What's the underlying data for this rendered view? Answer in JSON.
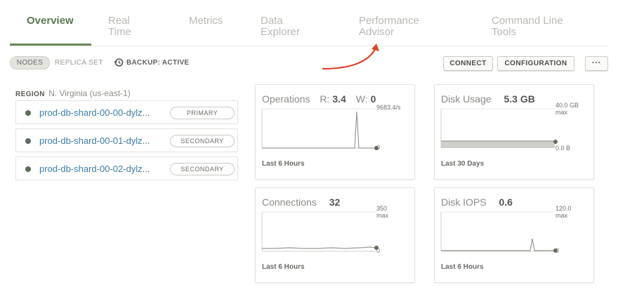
{
  "tabs": [
    {
      "label": "Overview",
      "active": true
    },
    {
      "label": "Real\nTime",
      "active": false
    },
    {
      "label": "Metrics",
      "active": false
    },
    {
      "label": "Data\nExplorer",
      "active": false
    },
    {
      "label": "Performance\nAdvisor",
      "active": false
    },
    {
      "label": "Command Line\nTools",
      "active": false
    }
  ],
  "subnav": {
    "nodes": "NODES",
    "replica_set": "REPLICA SET",
    "backup": "BACKUP: ACTIVE"
  },
  "toolbar": {
    "connect": "CONNECT",
    "configuration": "CONFIGURATION",
    "more": "···"
  },
  "region": {
    "label": "REGION",
    "value": "N. Virginia (us-east-1)"
  },
  "nodes": [
    {
      "name": "prod-db-shard-00-00-dylz...",
      "role": "PRIMARY"
    },
    {
      "name": "prod-db-shard-00-01-dylz...",
      "role": "SECONDARY"
    },
    {
      "name": "prod-db-shard-00-02-dylz...",
      "role": "SECONDARY"
    }
  ],
  "cards": {
    "operations": {
      "title": "Operations",
      "r_label": "R:",
      "r_value": "3.4",
      "w_label": "W:",
      "w_value": "0",
      "max": "9683.4/s",
      "zero": "0",
      "period": "Last 6 Hours"
    },
    "disk_usage": {
      "title": "Disk Usage",
      "value": "5.3 GB",
      "max": "40.0 GB",
      "max_sub": "max",
      "zero": "0.0 B",
      "period": "Last 30 Days"
    },
    "connections": {
      "title": "Connections",
      "value": "32",
      "max": "350",
      "max_sub": "max",
      "zero": "0",
      "period": "Last 6 Hours"
    },
    "disk_iops": {
      "title": "Disk IOPS",
      "value": "0.6",
      "max": "120.0",
      "max_sub": "max",
      "zero": "0",
      "period": "Last 6 Hours"
    }
  },
  "colors": {
    "accent": "#6b8a5c",
    "link": "#3d7ea6",
    "annotation_arrow": "#e0442b"
  }
}
